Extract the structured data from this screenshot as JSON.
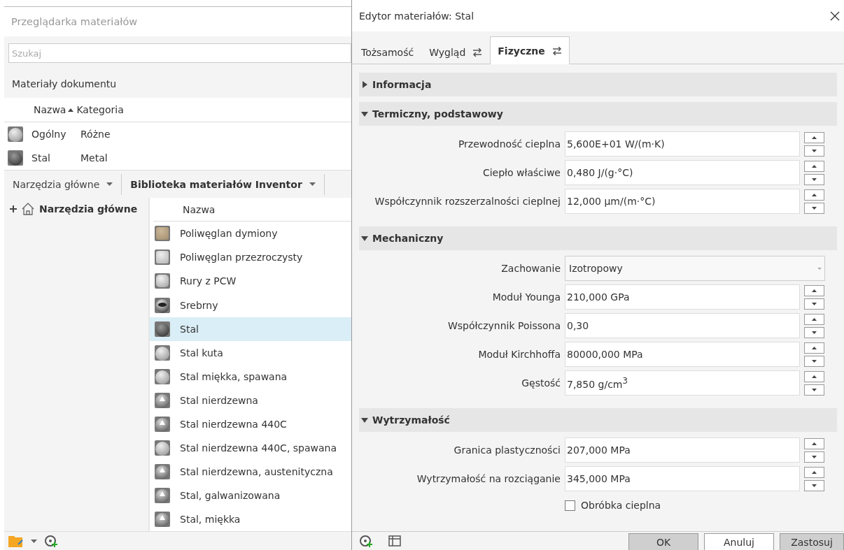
{
  "browser": {
    "title": "Przeglądarka materiałów",
    "search": {
      "placeholder": "Szukaj"
    },
    "document_header": "Materiały dokumentu",
    "document_columns": [
      {
        "label": "Nazwa",
        "sorted": true
      },
      {
        "label": "Kategoria",
        "sorted": false
      }
    ],
    "document_rows": [
      {
        "name": "Ogólny",
        "category": "Różne",
        "kind": "light-sphere"
      },
      {
        "name": "Stal",
        "category": "Metal",
        "kind": "dark-sphere"
      }
    ],
    "library_tabs": [
      {
        "label": "Narzędzia główne",
        "selected": false
      },
      {
        "label": "Biblioteka materiałów Inventor",
        "selected": true
      }
    ],
    "tree": [
      {
        "label": "Narzędzia główne",
        "expanded": false
      }
    ],
    "list_column": "Nazwa",
    "list": [
      {
        "name": "Poliwęglan dymiony",
        "kind": "tan-block",
        "selected": false
      },
      {
        "name": "Poliwęglan przezroczysty",
        "kind": "clear-block",
        "selected": false
      },
      {
        "name": "Rury z PCW",
        "kind": "cylinder",
        "selected": false
      },
      {
        "name": "Srebrny",
        "kind": "chrome",
        "selected": false
      },
      {
        "name": "Stal",
        "kind": "dark-sphere",
        "selected": true
      },
      {
        "name": "Stal kuta",
        "kind": "light-sphere",
        "selected": false
      },
      {
        "name": "Stal miękka, spawana",
        "kind": "light-sphere",
        "selected": false
      },
      {
        "name": "Stal nierdzewna",
        "kind": "mirror-sphere",
        "selected": false
      },
      {
        "name": "Stal nierdzewna 440C",
        "kind": "mirror-sphere",
        "selected": false
      },
      {
        "name": "Stal nierdzewna 440C, spawana",
        "kind": "light-sphere",
        "selected": false
      },
      {
        "name": "Stal nierdzewna, austenityczna",
        "kind": "mirror-sphere",
        "selected": false
      },
      {
        "name": "Stal, galwanizowana",
        "kind": "mirror-sphere",
        "selected": false
      },
      {
        "name": "Stal, miękka",
        "kind": "mirror-sphere",
        "selected": false
      }
    ]
  },
  "editor": {
    "title": "Edytor materiałów: Stal",
    "tabs": [
      {
        "label": "Tożsamość",
        "selected": false,
        "linked": false
      },
      {
        "label": "Wygląd",
        "selected": false,
        "linked": true
      },
      {
        "label": "Fizyczne",
        "selected": true,
        "linked": true
      }
    ],
    "sections": [
      {
        "title": "Informacja",
        "expanded": false
      },
      {
        "title": "Termiczny, podstawowy",
        "expanded": true,
        "fields": [
          {
            "kind": "number",
            "label": "Przewodność cieplna",
            "value": "5,600E+01 W/(m·K)"
          },
          {
            "kind": "number",
            "label": "Ciepło właściwe",
            "value": "0,480 J/(g·°C)"
          },
          {
            "kind": "number",
            "label": "Współczynnik rozszerzalności cieplnej",
            "value": "12,000 µm/(m·°C)"
          }
        ]
      },
      {
        "title": "Mechaniczny",
        "expanded": true,
        "fields": [
          {
            "kind": "select",
            "label": "Zachowanie",
            "value": "Izotropowy"
          },
          {
            "kind": "number",
            "label": "Moduł Younga",
            "value": "210,000 GPa"
          },
          {
            "kind": "number",
            "label": "Współczynnik Poissona",
            "value": "0,30"
          },
          {
            "kind": "number",
            "label": "Moduł Kirchhoffa",
            "value": "80000,000 MPa"
          },
          {
            "kind": "number",
            "label": "Gęstość",
            "value": "7,850 g/cm$^{3}$"
          }
        ]
      },
      {
        "title": "Wytrzymałość",
        "expanded": true,
        "fields": [
          {
            "kind": "number",
            "label": "Granica plastyczności",
            "value": "207,000 MPa"
          },
          {
            "kind": "number",
            "label": "Wytrzymałość na rozciąganie",
            "value": "345,000 MPa"
          },
          {
            "kind": "checkbox",
            "label": "Obróbka cieplna",
            "checked": false
          }
        ]
      }
    ],
    "buttons": [
      {
        "label": "OK",
        "kind": "primary"
      },
      {
        "label": "Anuluj",
        "kind": "normal"
      },
      {
        "label": "Zastosuj",
        "kind": "primary"
      }
    ]
  }
}
